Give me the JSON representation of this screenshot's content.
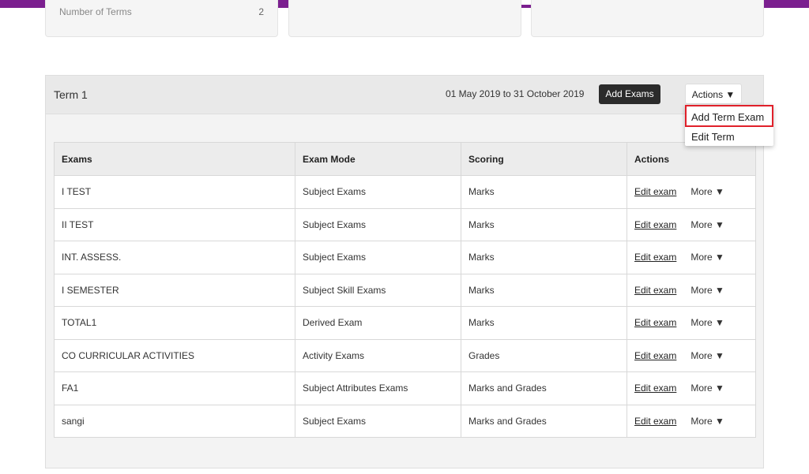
{
  "summary_cards": [
    {
      "label": "Number of Terms",
      "value": "2"
    },
    {
      "label": "",
      "value": ""
    },
    {
      "label": "",
      "value": ""
    }
  ],
  "term": {
    "title": "Term 1",
    "dates": "01 May 2019 to 31 October 2019",
    "add_exams_label": "Add Exams",
    "actions_label": "Actions ▼"
  },
  "dropdown": {
    "items": [
      "Add Term Exam",
      "Edit Term"
    ]
  },
  "table": {
    "headers": [
      "Exams",
      "Exam Mode",
      "Scoring",
      "Actions"
    ],
    "rows": [
      {
        "exam": "I TEST",
        "mode": "Subject Exams",
        "scoring": "Marks",
        "edit": "Edit exam",
        "more": "More ▼"
      },
      {
        "exam": "II TEST",
        "mode": "Subject Exams",
        "scoring": "Marks",
        "edit": "Edit exam",
        "more": "More ▼"
      },
      {
        "exam": "INT. ASSESS.",
        "mode": "Subject Exams",
        "scoring": "Marks",
        "edit": "Edit exam",
        "more": "More ▼"
      },
      {
        "exam": "I SEMESTER",
        "mode": "Subject Skill Exams",
        "scoring": "Marks",
        "edit": "Edit exam",
        "more": "More ▼"
      },
      {
        "exam": "TOTAL1",
        "mode": "Derived Exam",
        "scoring": "Marks",
        "edit": "Edit exam",
        "more": "More ▼"
      },
      {
        "exam": "CO CURRICULAR ACTIVITIES",
        "mode": "Activity Exams",
        "scoring": "Grades",
        "edit": "Edit exam",
        "more": "More ▼"
      },
      {
        "exam": "FA1",
        "mode": "Subject Attributes Exams",
        "scoring": "Marks and Grades",
        "edit": "Edit exam",
        "more": "More ▼"
      },
      {
        "exam": "sangi",
        "mode": "Subject Exams",
        "scoring": "Marks and Grades",
        "edit": "Edit exam",
        "more": "More ▼"
      }
    ]
  },
  "colors": {
    "topbar": "#7b1f8f",
    "highlight": "#e0202a",
    "button_dark": "#2b2b2b"
  }
}
